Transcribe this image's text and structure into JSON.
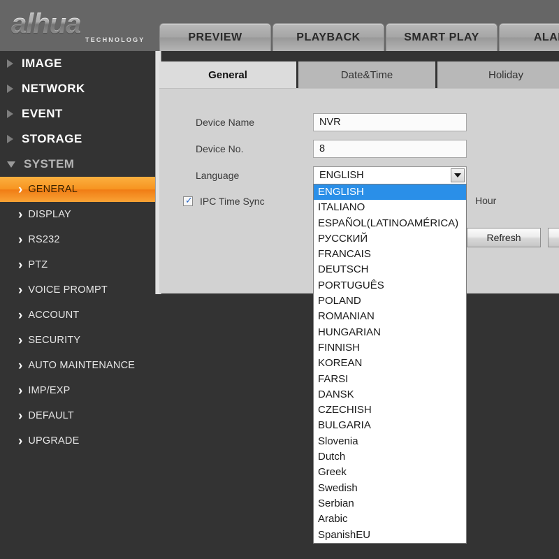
{
  "brand": {
    "name": "alhua",
    "tagline": "TECHNOLOGY"
  },
  "topnav": {
    "tabs": [
      {
        "label": "PREVIEW"
      },
      {
        "label": "PLAYBACK"
      },
      {
        "label": "SMART PLAY"
      },
      {
        "label": "ALARM"
      }
    ]
  },
  "sidebar": {
    "groups": [
      {
        "label": "IMAGE",
        "expanded": false
      },
      {
        "label": "NETWORK",
        "expanded": false
      },
      {
        "label": "EVENT",
        "expanded": false
      },
      {
        "label": "STORAGE",
        "expanded": false
      },
      {
        "label": "SYSTEM",
        "expanded": true
      }
    ],
    "items": [
      {
        "label": "GENERAL",
        "active": true
      },
      {
        "label": "DISPLAY",
        "active": false
      },
      {
        "label": "RS232",
        "active": false
      },
      {
        "label": "PTZ",
        "active": false
      },
      {
        "label": "VOICE PROMPT",
        "active": false
      },
      {
        "label": "ACCOUNT",
        "active": false
      },
      {
        "label": "SECURITY",
        "active": false
      },
      {
        "label": "AUTO MAINTENANCE",
        "active": false
      },
      {
        "label": "IMP/EXP",
        "active": false
      },
      {
        "label": "DEFAULT",
        "active": false
      },
      {
        "label": "UPGRADE",
        "active": false
      }
    ]
  },
  "content": {
    "tabs": [
      {
        "label": "General",
        "active": true
      },
      {
        "label": "Date&Time",
        "active": false
      },
      {
        "label": "Holiday",
        "active": false
      }
    ],
    "fields": {
      "device_name_label": "Device Name",
      "device_name_value": "NVR",
      "device_no_label": "Device No.",
      "device_no_value": "8",
      "language_label": "Language",
      "language_value": "ENGLISH",
      "ipc_time_sync_label": "IPC Time Sync",
      "ipc_time_sync_checked": "✓",
      "hour_label": "Hour"
    },
    "buttons": {
      "refresh": "Refresh",
      "secondary": ""
    }
  },
  "language_dropdown": {
    "selected": "ENGLISH",
    "options": [
      "ENGLISH",
      "ITALIANO",
      "ESPAÑOL(LATINOAMÉRICA)",
      "РУССКИЙ",
      "FRANCAIS",
      "DEUTSCH",
      "PORTUGUÊS",
      "POLAND",
      "ROMANIAN",
      "HUNGARIAN",
      "FINNISH",
      "KOREAN",
      "FARSI",
      "DANSK",
      "CZECHISH",
      "BULGARIA",
      "Slovenia",
      "Dutch",
      "Greek",
      "Swedish",
      "Serbian",
      "Arabic",
      "SpanishEU"
    ]
  },
  "colors": {
    "accent_orange": "#f79420",
    "selection_blue": "#2a8fe8",
    "header_gray": "#666666",
    "sidebar_dark": "#333333",
    "panel_gray": "#d2d2d2"
  }
}
